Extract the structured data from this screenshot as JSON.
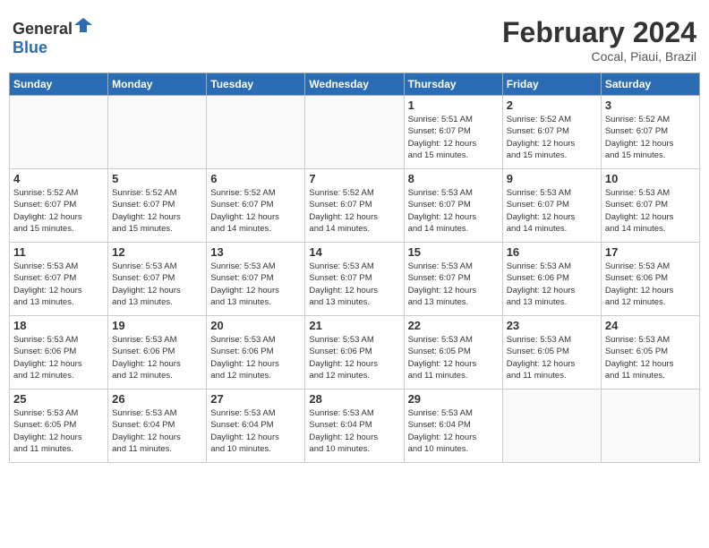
{
  "header": {
    "logo_general": "General",
    "logo_blue": "Blue",
    "month_year": "February 2024",
    "location": "Cocal, Piaui, Brazil"
  },
  "days_of_week": [
    "Sunday",
    "Monday",
    "Tuesday",
    "Wednesday",
    "Thursday",
    "Friday",
    "Saturday"
  ],
  "weeks": [
    [
      {
        "day": "",
        "info": ""
      },
      {
        "day": "",
        "info": ""
      },
      {
        "day": "",
        "info": ""
      },
      {
        "day": "",
        "info": ""
      },
      {
        "day": "1",
        "info": "Sunrise: 5:51 AM\nSunset: 6:07 PM\nDaylight: 12 hours\nand 15 minutes."
      },
      {
        "day": "2",
        "info": "Sunrise: 5:52 AM\nSunset: 6:07 PM\nDaylight: 12 hours\nand 15 minutes."
      },
      {
        "day": "3",
        "info": "Sunrise: 5:52 AM\nSunset: 6:07 PM\nDaylight: 12 hours\nand 15 minutes."
      }
    ],
    [
      {
        "day": "4",
        "info": "Sunrise: 5:52 AM\nSunset: 6:07 PM\nDaylight: 12 hours\nand 15 minutes."
      },
      {
        "day": "5",
        "info": "Sunrise: 5:52 AM\nSunset: 6:07 PM\nDaylight: 12 hours\nand 15 minutes."
      },
      {
        "day": "6",
        "info": "Sunrise: 5:52 AM\nSunset: 6:07 PM\nDaylight: 12 hours\nand 14 minutes."
      },
      {
        "day": "7",
        "info": "Sunrise: 5:52 AM\nSunset: 6:07 PM\nDaylight: 12 hours\nand 14 minutes."
      },
      {
        "day": "8",
        "info": "Sunrise: 5:53 AM\nSunset: 6:07 PM\nDaylight: 12 hours\nand 14 minutes."
      },
      {
        "day": "9",
        "info": "Sunrise: 5:53 AM\nSunset: 6:07 PM\nDaylight: 12 hours\nand 14 minutes."
      },
      {
        "day": "10",
        "info": "Sunrise: 5:53 AM\nSunset: 6:07 PM\nDaylight: 12 hours\nand 14 minutes."
      }
    ],
    [
      {
        "day": "11",
        "info": "Sunrise: 5:53 AM\nSunset: 6:07 PM\nDaylight: 12 hours\nand 13 minutes."
      },
      {
        "day": "12",
        "info": "Sunrise: 5:53 AM\nSunset: 6:07 PM\nDaylight: 12 hours\nand 13 minutes."
      },
      {
        "day": "13",
        "info": "Sunrise: 5:53 AM\nSunset: 6:07 PM\nDaylight: 12 hours\nand 13 minutes."
      },
      {
        "day": "14",
        "info": "Sunrise: 5:53 AM\nSunset: 6:07 PM\nDaylight: 12 hours\nand 13 minutes."
      },
      {
        "day": "15",
        "info": "Sunrise: 5:53 AM\nSunset: 6:07 PM\nDaylight: 12 hours\nand 13 minutes."
      },
      {
        "day": "16",
        "info": "Sunrise: 5:53 AM\nSunset: 6:06 PM\nDaylight: 12 hours\nand 13 minutes."
      },
      {
        "day": "17",
        "info": "Sunrise: 5:53 AM\nSunset: 6:06 PM\nDaylight: 12 hours\nand 12 minutes."
      }
    ],
    [
      {
        "day": "18",
        "info": "Sunrise: 5:53 AM\nSunset: 6:06 PM\nDaylight: 12 hours\nand 12 minutes."
      },
      {
        "day": "19",
        "info": "Sunrise: 5:53 AM\nSunset: 6:06 PM\nDaylight: 12 hours\nand 12 minutes."
      },
      {
        "day": "20",
        "info": "Sunrise: 5:53 AM\nSunset: 6:06 PM\nDaylight: 12 hours\nand 12 minutes."
      },
      {
        "day": "21",
        "info": "Sunrise: 5:53 AM\nSunset: 6:06 PM\nDaylight: 12 hours\nand 12 minutes."
      },
      {
        "day": "22",
        "info": "Sunrise: 5:53 AM\nSunset: 6:05 PM\nDaylight: 12 hours\nand 11 minutes."
      },
      {
        "day": "23",
        "info": "Sunrise: 5:53 AM\nSunset: 6:05 PM\nDaylight: 12 hours\nand 11 minutes."
      },
      {
        "day": "24",
        "info": "Sunrise: 5:53 AM\nSunset: 6:05 PM\nDaylight: 12 hours\nand 11 minutes."
      }
    ],
    [
      {
        "day": "25",
        "info": "Sunrise: 5:53 AM\nSunset: 6:05 PM\nDaylight: 12 hours\nand 11 minutes."
      },
      {
        "day": "26",
        "info": "Sunrise: 5:53 AM\nSunset: 6:04 PM\nDaylight: 12 hours\nand 11 minutes."
      },
      {
        "day": "27",
        "info": "Sunrise: 5:53 AM\nSunset: 6:04 PM\nDaylight: 12 hours\nand 10 minutes."
      },
      {
        "day": "28",
        "info": "Sunrise: 5:53 AM\nSunset: 6:04 PM\nDaylight: 12 hours\nand 10 minutes."
      },
      {
        "day": "29",
        "info": "Sunrise: 5:53 AM\nSunset: 6:04 PM\nDaylight: 12 hours\nand 10 minutes."
      },
      {
        "day": "",
        "info": ""
      },
      {
        "day": "",
        "info": ""
      }
    ]
  ]
}
